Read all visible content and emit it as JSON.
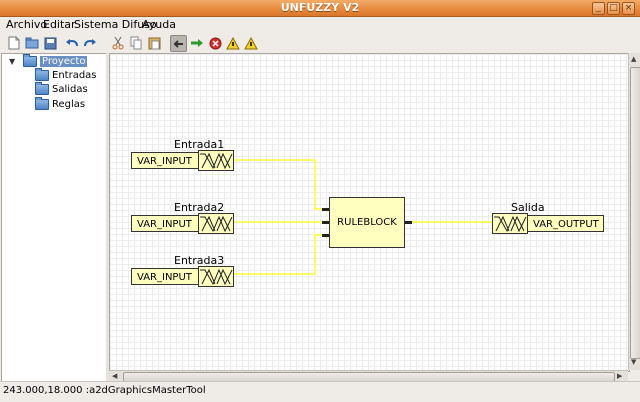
{
  "window": {
    "title": "UNFUZZY V2"
  },
  "menu": {
    "items": [
      "Archivo",
      "Editar",
      "Sistema Difuso",
      "Ayuda"
    ]
  },
  "toolbar": {
    "buttons": [
      "new-file-icon",
      "open-folder-icon",
      "save-icon",
      "undo-icon",
      "redo-icon",
      "cut-icon",
      "copy-icon",
      "paste-icon",
      "pointer-tool-icon",
      "add-icon",
      "delete-icon",
      "warning-icon",
      "warning-icon-2"
    ]
  },
  "tree": {
    "root": "Proyecto",
    "children": [
      "Entradas",
      "Salidas",
      "Reglas"
    ]
  },
  "diagram": {
    "inputs": [
      {
        "label": "Entrada1",
        "var_type": "VAR_INPUT"
      },
      {
        "label": "Entrada2",
        "var_type": "VAR_INPUT"
      },
      {
        "label": "Entrada3",
        "var_type": "VAR_INPUT"
      }
    ],
    "rule_block": "RULEBLOCK",
    "output": {
      "label": "Salida",
      "var_type": "VAR_OUTPUT"
    },
    "colors": {
      "block_fill": "#ffffc0",
      "wire": "#ffff33",
      "border": "#333333"
    }
  },
  "status": {
    "text": "243.000,18.000 :a2dGraphicsMasterTool"
  }
}
